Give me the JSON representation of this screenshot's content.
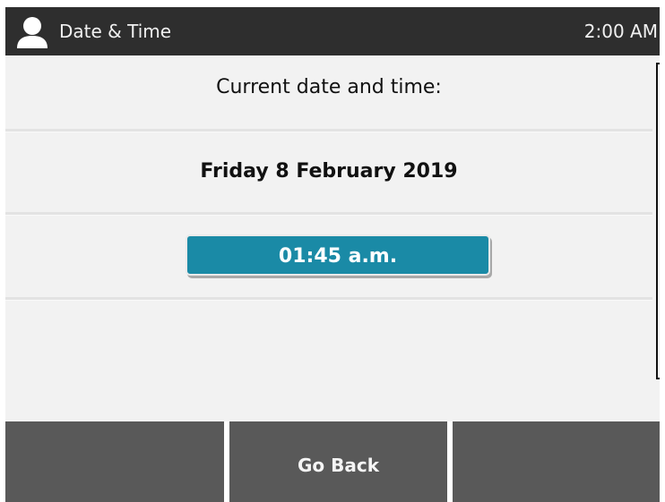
{
  "status_bar": {
    "title": "Date & Time",
    "clock": "2:00 AM",
    "user_icon": "user-icon"
  },
  "content": {
    "label": "Current date and time:",
    "date": "Friday 8 February 2019",
    "time_button": "01:45 a.m."
  },
  "softkeys": [
    {
      "label": ""
    },
    {
      "label": "Go Back"
    },
    {
      "label": ""
    }
  ],
  "colors": {
    "status_bar_bg": "#2e2e2e",
    "content_bg": "#f2f2f2",
    "accent_button": "#1a8aa6",
    "softkey_bg": "#595959"
  }
}
